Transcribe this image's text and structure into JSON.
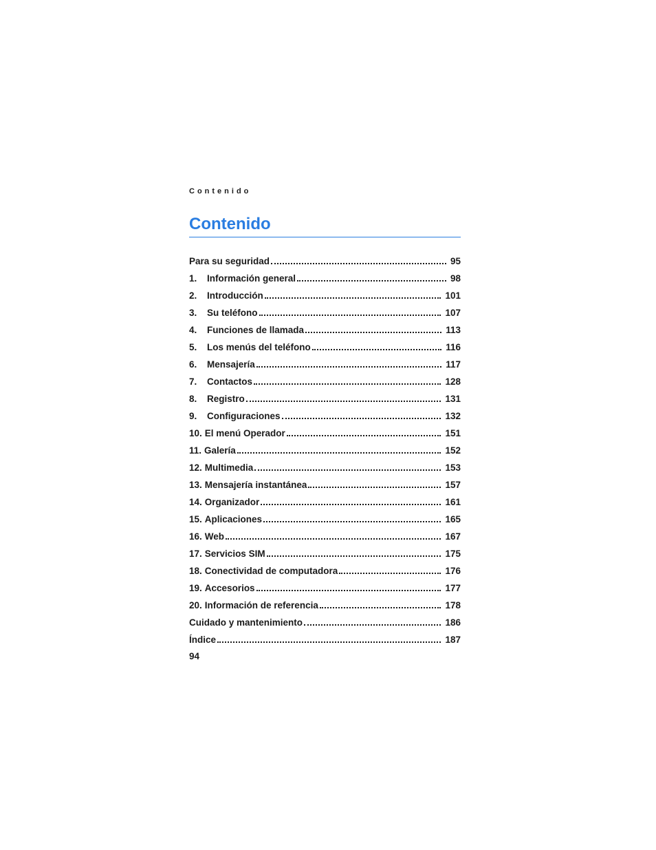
{
  "running_header": "Contenido",
  "title": "Contenido",
  "footer_page": "94",
  "toc": [
    {
      "num": "",
      "title": "Para su seguridad",
      "page": "95"
    },
    {
      "num": "1.",
      "title": "Información general",
      "page": "98"
    },
    {
      "num": "2.",
      "title": "Introducción",
      "page": "101"
    },
    {
      "num": "3.",
      "title": "Su teléfono",
      "page": "107"
    },
    {
      "num": "4.",
      "title": "Funciones de llamada",
      "page": "113"
    },
    {
      "num": "5.",
      "title": "Los menús del teléfono",
      "page": "116"
    },
    {
      "num": "6.",
      "title": "Mensajería",
      "page": "117"
    },
    {
      "num": "7.",
      "title": "Contactos",
      "page": "128"
    },
    {
      "num": "8.",
      "title": "Registro",
      "page": "131"
    },
    {
      "num": "9.",
      "title": "Configuraciones",
      "page": "132"
    },
    {
      "num": "10.",
      "title": "El menú Operador",
      "page": "151"
    },
    {
      "num": "11.",
      "title": "Galería",
      "page": "152"
    },
    {
      "num": "12.",
      "title": "Multimedia",
      "page": "153"
    },
    {
      "num": "13.",
      "title": "Mensajería instantánea",
      "page": "157"
    },
    {
      "num": "14.",
      "title": "Organizador",
      "page": "161"
    },
    {
      "num": "15.",
      "title": "Aplicaciones",
      "page": "165"
    },
    {
      "num": "16.",
      "title": "Web",
      "page": "167"
    },
    {
      "num": "17.",
      "title": "Servicios SIM",
      "page": "175"
    },
    {
      "num": "18.",
      "title": "Conectividad de computadora",
      "page": "176"
    },
    {
      "num": "19.",
      "title": "Accesorios",
      "page": "177"
    },
    {
      "num": "20.",
      "title": "Información de referencia",
      "page": "178"
    },
    {
      "num": "",
      "title": "Cuidado y mantenimiento",
      "page": "186"
    },
    {
      "num": "",
      "title": "Índice",
      "page": "187"
    }
  ]
}
